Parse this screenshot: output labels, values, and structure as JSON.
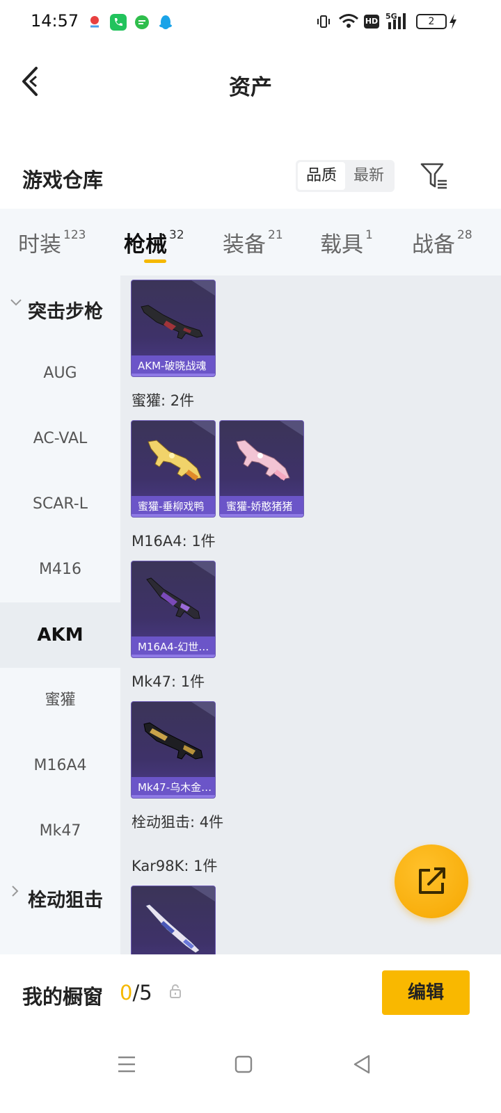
{
  "status_bar": {
    "time": "14:57",
    "battery": "2",
    "app_icons": [
      "map-pin-app-icon",
      "phone-app-icon",
      "message-app-icon",
      "qq-app-icon"
    ],
    "system_icons": [
      "vibrate-icon",
      "wifi-icon",
      "hd-icon",
      "5g-signal-icon",
      "battery-icon",
      "charging-icon"
    ]
  },
  "header": {
    "title": "资产"
  },
  "warehouse": {
    "title": "游戏仓库",
    "sort_options": [
      "品质",
      "最新"
    ],
    "sort_selected": "品质"
  },
  "tabs": [
    {
      "label": "时装",
      "count": "123"
    },
    {
      "label": "枪械",
      "count": "32",
      "active": true
    },
    {
      "label": "装备",
      "count": "21"
    },
    {
      "label": "载具",
      "count": "1"
    },
    {
      "label": "战备",
      "count": "28"
    }
  ],
  "sidebar": {
    "group_expanded": "突击步枪",
    "items": [
      "AUG",
      "AC-VAL",
      "SCAR-L",
      "M416",
      "AKM",
      "蜜獾",
      "M16A4",
      "Mk47"
    ],
    "active_item": "AKM",
    "group_collapsed": "栓动狙击"
  },
  "content": {
    "akm_card": "AKM-破晓战魂",
    "honey_badger_head": "蜜獾: 2件",
    "honey_badger_cards": [
      "蜜獾-垂柳戏鸭",
      "蜜獾-娇憨猪猪"
    ],
    "m16a4_head": "M16A4: 1件",
    "m16a4_card": "M16A4-幻世…",
    "mk47_head": "Mk47: 1件",
    "mk47_card": "Mk47-乌木金…",
    "bolt_head": "栓动狙击: 4件",
    "kar98k_head": "Kar98K: 1件"
  },
  "showcase": {
    "label": "我的橱窗",
    "current": "0",
    "separator_total": "/5",
    "edit_label": "编辑"
  },
  "colors": {
    "accent": "#f5b800",
    "card_bg": "#3e3269",
    "card_caption": "#6b55c8"
  }
}
